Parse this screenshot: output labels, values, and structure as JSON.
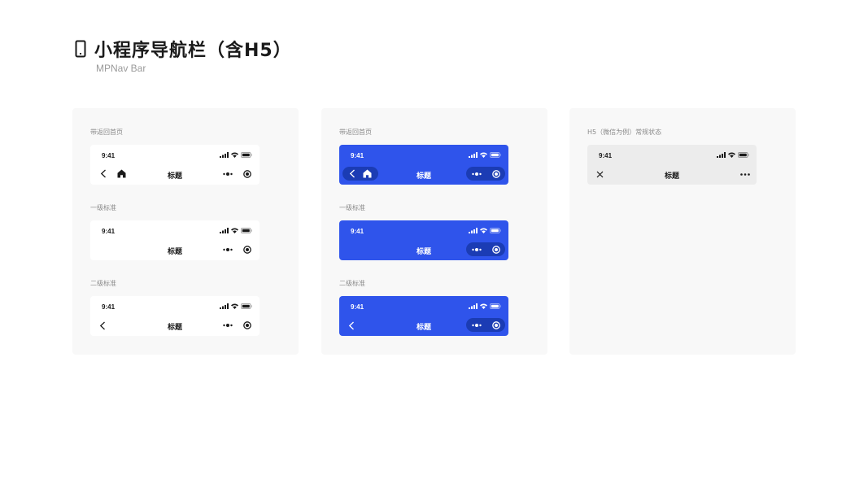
{
  "page": {
    "title": "小程序导航栏（含H5）",
    "subtitle": "MPNav Bar"
  },
  "colors": {
    "brand_blue": "#2f54eb",
    "capsule_blue": "#1b3cb4",
    "panel_bg": "#f8f8f8",
    "h5_bar_bg": "#ececec"
  },
  "panels": [
    {
      "sections": [
        {
          "label": "带返回首页",
          "time": "9:41",
          "title": "标题"
        },
        {
          "label": "一级标准",
          "time": "9:41",
          "title": "标题"
        },
        {
          "label": "二级标准",
          "time": "9:41",
          "title": "标题"
        }
      ]
    },
    {
      "sections": [
        {
          "label": "带返回首页",
          "time": "9:41",
          "title": "标题"
        },
        {
          "label": "一级标准",
          "time": "9:41",
          "title": "标题"
        },
        {
          "label": "二级标准",
          "time": "9:41",
          "title": "标题"
        }
      ]
    },
    {
      "sections": [
        {
          "label": "H5（微信为例）常规状态",
          "time": "9:41",
          "title": "标题"
        }
      ]
    }
  ],
  "icons": [
    "phone-icon",
    "signal-icon",
    "wifi-icon",
    "battery-icon",
    "back-arrow-icon",
    "home-icon",
    "more-icon",
    "target-icon",
    "close-icon"
  ]
}
